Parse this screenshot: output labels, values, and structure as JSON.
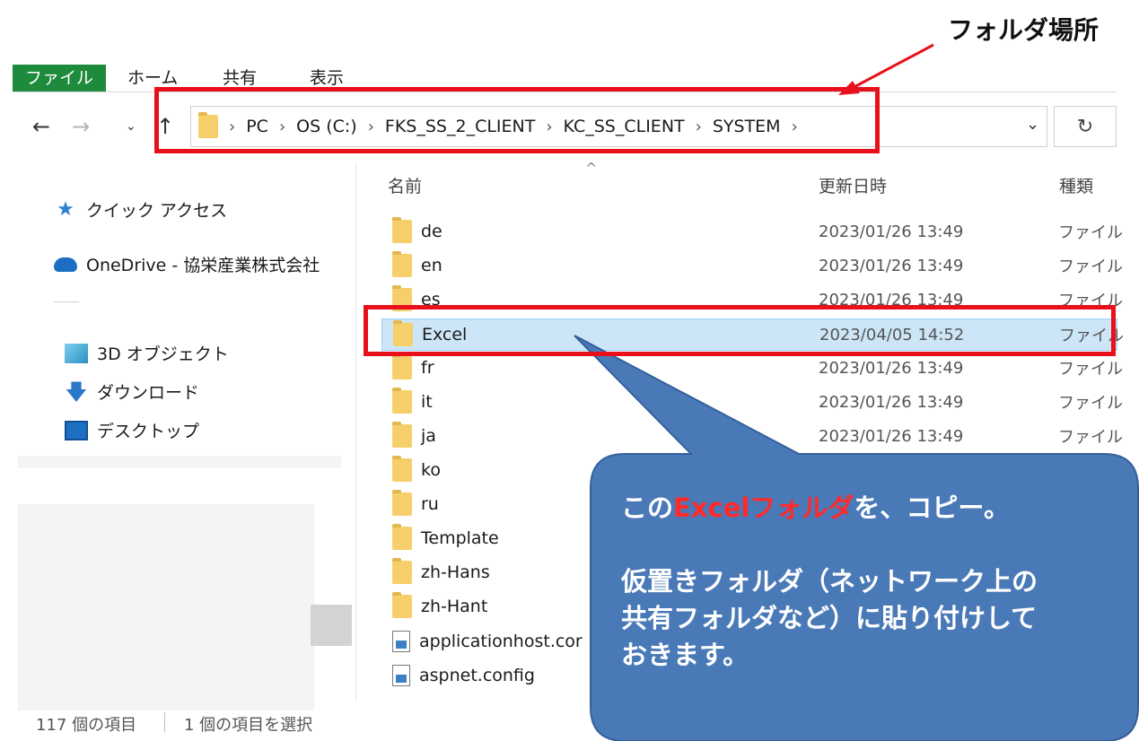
{
  "ribbon": {
    "tabs": [
      "ファイル",
      "ホーム",
      "共有",
      "表示"
    ]
  },
  "address": {
    "crumbs": [
      "PC",
      "OS (C:)",
      "FKS_SS_2_CLIENT",
      "KC_SS_CLIENT",
      "SYSTEM"
    ],
    "separator": "›"
  },
  "nav_pane": {
    "quick_access": "クイック アクセス",
    "onedrive": "OneDrive - 協栄産業株式会社",
    "objects_3d": "3D オブジェクト",
    "downloads": "ダウンロード",
    "desktop": "デスクトップ"
  },
  "columns": {
    "name": "名前",
    "date": "更新日時",
    "type": "種類"
  },
  "files": [
    {
      "name": "de",
      "date": "2023/01/26 13:49",
      "type": "ファイル",
      "kind": "folder"
    },
    {
      "name": "en",
      "date": "2023/01/26 13:49",
      "type": "ファイル",
      "kind": "folder"
    },
    {
      "name": "es",
      "date": "2023/01/26 13:49",
      "type": "ファイル",
      "kind": "folder"
    },
    {
      "name": "Excel",
      "date": "2023/04/05 14:52",
      "type": "ファイル",
      "kind": "folder",
      "selected": true
    },
    {
      "name": "fr",
      "date": "2023/01/26 13:49",
      "type": "ファイル",
      "kind": "folder"
    },
    {
      "name": "it",
      "date": "2023/01/26 13:49",
      "type": "ファイル",
      "kind": "folder"
    },
    {
      "name": "ja",
      "date": "2023/01/26 13:49",
      "type": "ファイル",
      "kind": "folder"
    },
    {
      "name": "ko",
      "date": "",
      "type": "",
      "kind": "folder"
    },
    {
      "name": "ru",
      "date": "",
      "type": "",
      "kind": "folder"
    },
    {
      "name": "Template",
      "date": "",
      "type": "",
      "kind": "folder"
    },
    {
      "name": "zh-Hans",
      "date": "",
      "type": "",
      "kind": "folder"
    },
    {
      "name": "zh-Hant",
      "date": "",
      "type": "",
      "kind": "folder"
    },
    {
      "name": "applicationhost.cor",
      "date": "",
      "type": "",
      "kind": "file"
    },
    {
      "name": "aspnet.config",
      "date": "",
      "type": "",
      "kind": "file"
    }
  ],
  "status": {
    "count": "117 個の項目",
    "selected": "1 個の項目を選択"
  },
  "annotation": {
    "label": "フォルダ場所",
    "line1_prefix": "この",
    "line1_highlight": "Excelフォルダ",
    "line1_suffix": "を、コピー。",
    "line2": "仮置きフォルダ（ネットワーク上の",
    "line3": "共有フォルダなど）に貼り付けして",
    "line4": "おきます。",
    "box_color": "#e8101a",
    "callout_color": "#4a79b8"
  }
}
